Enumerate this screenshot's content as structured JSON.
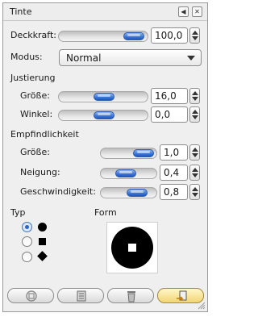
{
  "window": {
    "title": "Tinte"
  },
  "titlebar_buttons": [
    {
      "name": "menu-arrow-icon",
      "glyph": "◀"
    },
    {
      "name": "close-icon",
      "glyph": "✕"
    }
  ],
  "opacity": {
    "label": "Deckkraft:",
    "value": "100,0",
    "level_percent": 100
  },
  "mode": {
    "label": "Modus:",
    "value": "Normal"
  },
  "adjustment": {
    "heading": "Justierung",
    "size": {
      "label": "Größe:",
      "value": "16,0"
    },
    "angle": {
      "label": "Winkel:",
      "value": "0,0"
    }
  },
  "sensitivity": {
    "heading": "Empfindlichkeit",
    "size": {
      "label": "Größe:",
      "value": "1,0"
    },
    "tilt": {
      "label": "Neigung:",
      "value": "0,4"
    },
    "speed": {
      "label": "Geschwindigkeit:",
      "value": "0,8"
    }
  },
  "type": {
    "heading": "Typ",
    "options": [
      "circle",
      "square",
      "diamond"
    ],
    "selected": "circle"
  },
  "shape": {
    "heading": "Form"
  },
  "bottom_buttons": [
    {
      "name": "save-button",
      "icon": "save-icon"
    },
    {
      "name": "restore-button",
      "icon": "restore-icon"
    },
    {
      "name": "delete-button",
      "icon": "trash-icon"
    },
    {
      "name": "reset-button",
      "icon": "reset-icon"
    }
  ],
  "colors": {
    "accent": "#3f78d8",
    "panel_bg": "#efefef"
  }
}
